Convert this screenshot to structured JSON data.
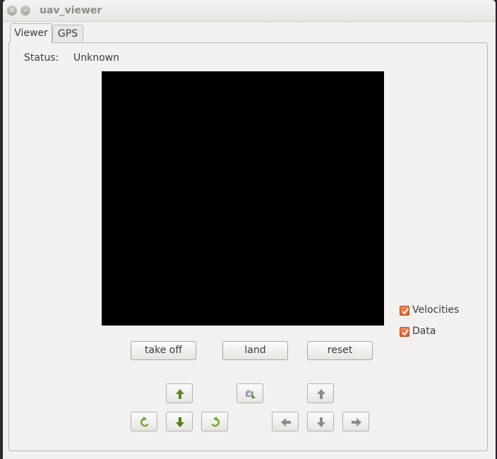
{
  "window": {
    "title": "uav_viewer"
  },
  "tabs": [
    {
      "label": "Viewer",
      "active": true
    },
    {
      "label": "GPS",
      "active": false
    }
  ],
  "status": {
    "label": "Status:",
    "value": "Unknown"
  },
  "options": {
    "velocities": {
      "label": "Velocities",
      "checked": true
    },
    "data": {
      "label": "Data",
      "checked": true
    }
  },
  "actions": {
    "take_off": "take off",
    "land": "land",
    "reset": "reset"
  },
  "controls": {
    "left_cluster": [
      "up-arrow-icon",
      "rotate-left-icon",
      "down-arrow-icon",
      "rotate-right-icon"
    ],
    "camera": "camera-switch-icon",
    "right_cluster": [
      "up-arrow-icon",
      "left-arrow-icon",
      "down-arrow-icon",
      "right-arrow-icon"
    ]
  },
  "colors": {
    "accent": "#e05f2c",
    "green_icon": "#5a8a1e",
    "gray_icon": "#8a8a8a",
    "video_bg": "#000000"
  }
}
